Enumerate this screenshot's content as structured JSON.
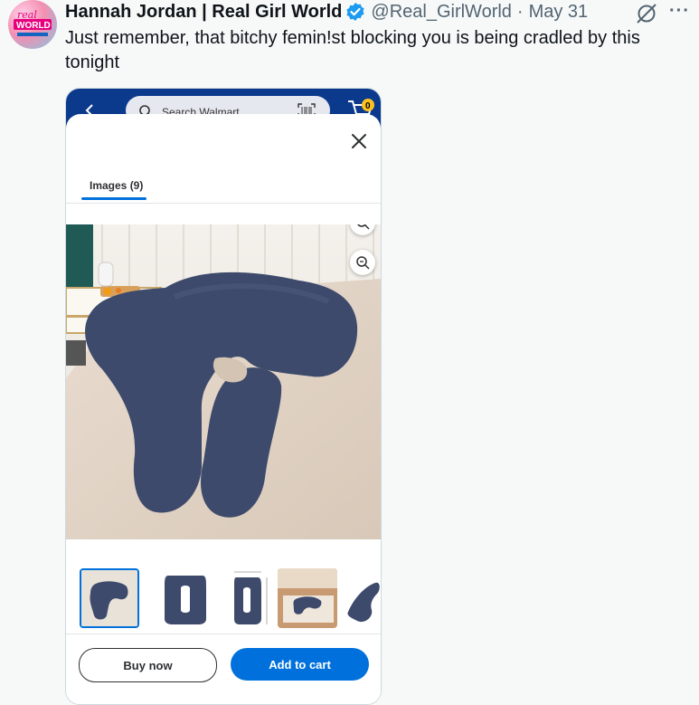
{
  "tweet": {
    "author_name": "Hannah Jordan | Real Girl World",
    "handle": "@Real_GirlWorld",
    "separator": "·",
    "date": "May 31",
    "text": "Just remember, that bitchy femin!st blocking you is being cradled by this tonight",
    "more_label": "···",
    "avatar_text": {
      "line1": "real",
      "line2": "WORLD"
    }
  },
  "shop_screenshot": {
    "search_placeholder": "Search Walmart",
    "cart_count": "0",
    "tab_label": "Images (9)",
    "buy_now_label": "Buy now",
    "add_to_cart_label": "Add to cart",
    "thumbnails": [
      "thumb-1",
      "thumb-2",
      "thumb-3",
      "thumb-4",
      "thumb-5"
    ],
    "selected_thumbnail": 0
  },
  "colors": {
    "accent_blue": "#0071dc",
    "verified_blue": "#1d9bf0",
    "walmart_header": "#0b3a8c",
    "pillow_navy": "#3d4a6b"
  }
}
